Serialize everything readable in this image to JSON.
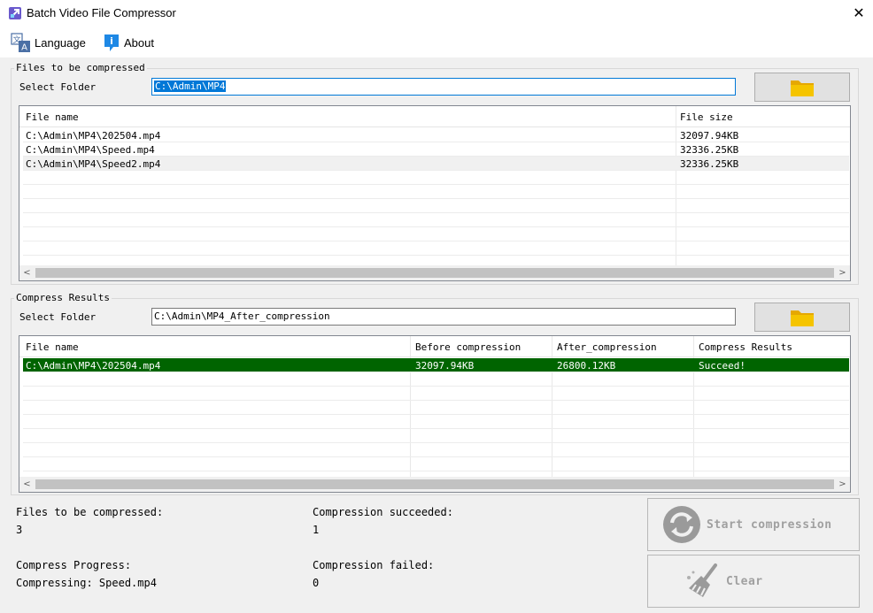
{
  "window": {
    "title": "Batch Video File Compressor",
    "close_glyph": "✕"
  },
  "menu": [
    {
      "label": "Language",
      "icon": "language-icon"
    },
    {
      "label": "About",
      "icon": "info-icon"
    }
  ],
  "source": {
    "group_title": "Files to be compressed",
    "folder_label": "Select Folder",
    "folder_value": "C:\\Admin\\MP4",
    "columns": [
      "File name",
      "File size"
    ],
    "rows": [
      {
        "name": "C:\\Admin\\MP4\\202504.mp4",
        "size": "32097.94KB"
      },
      {
        "name": "C:\\Admin\\MP4\\Speed.mp4",
        "size": "32336.25KB"
      },
      {
        "name": "C:\\Admin\\MP4\\Speed2.mp4",
        "size": "32336.25KB"
      }
    ]
  },
  "results": {
    "group_title": "Compress Results",
    "folder_label": "Select Folder",
    "folder_value": "C:\\Admin\\MP4_After_compression",
    "columns": [
      "File name",
      "Before compression",
      "After_compression",
      "Compress Results"
    ],
    "rows": [
      {
        "name": "C:\\Admin\\MP4\\202504.mp4",
        "before": "32097.94KB",
        "after": "26800.12KB",
        "result": "Succeed!"
      }
    ]
  },
  "status": {
    "files_label": "Files to be compressed:",
    "files_value": "3",
    "succeeded_label": "Compression succeeded:",
    "succeeded_value": "1",
    "progress_label": "Compress Progress:",
    "progress_value": "Compressing: Speed.mp4",
    "failed_label": "Compression failed:",
    "failed_value": "0"
  },
  "buttons": {
    "start_label": "Start compression",
    "clear_label": "Clear"
  },
  "colors": {
    "accent": "#0078d7",
    "success_row": "#006400",
    "folder": "#f5c400"
  }
}
